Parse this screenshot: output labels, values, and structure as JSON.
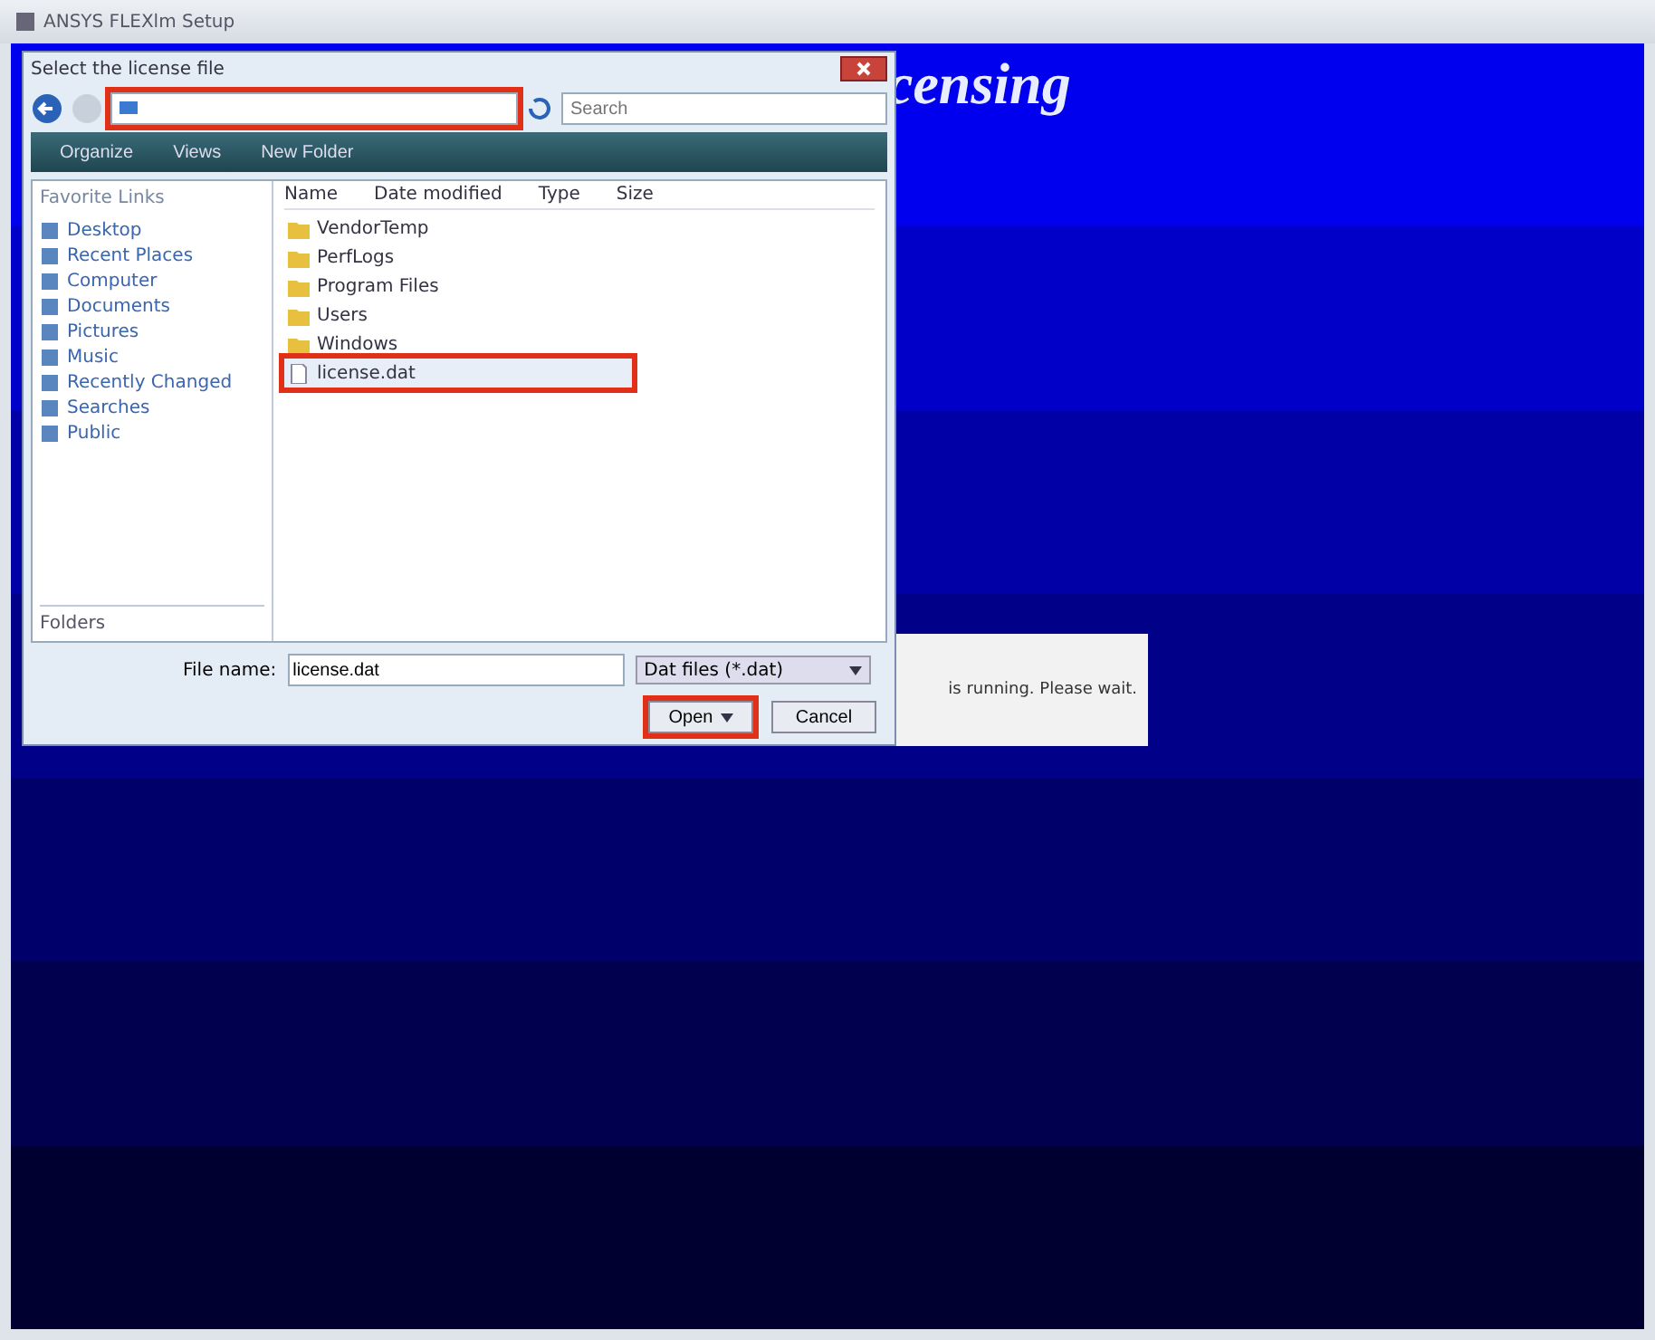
{
  "window": {
    "title": "ANSYS FLEXlm Setup"
  },
  "banner": {
    "text": "censing"
  },
  "message_box": {
    "text": "is running. Please wait."
  },
  "dialog": {
    "title": "Select the license file",
    "address": {
      "highlighted": true
    },
    "search": {
      "placeholder": "Search"
    },
    "toolbar": [
      "Organize",
      "Views",
      "New Folder"
    ],
    "favorites_heading": "Favorite Links",
    "favorites": [
      "Desktop",
      "Recent Places",
      "Computer",
      "Documents",
      "Pictures",
      "Music",
      "Recently Changed",
      "Searches",
      "Public"
    ],
    "folders_label": "Folders",
    "columns": [
      "Name",
      "Date modified",
      "Type",
      "Size"
    ],
    "files": [
      {
        "name": "VendorTemp",
        "kind": "folder",
        "selected": false,
        "highlighted": false
      },
      {
        "name": "PerfLogs",
        "kind": "folder",
        "selected": false,
        "highlighted": false
      },
      {
        "name": "Program Files",
        "kind": "folder",
        "selected": false,
        "highlighted": false
      },
      {
        "name": "Users",
        "kind": "folder",
        "selected": false,
        "highlighted": false
      },
      {
        "name": "Windows",
        "kind": "folder",
        "selected": false,
        "highlighted": false
      },
      {
        "name": "license.dat",
        "kind": "file",
        "selected": true,
        "highlighted": true
      }
    ],
    "filename_label": "File name:",
    "filename": "license.dat",
    "filetype": "Dat files (*.dat)",
    "buttons": [
      {
        "label": "Open",
        "kind": "split",
        "highlighted": true
      },
      {
        "label": "Cancel",
        "kind": "plain",
        "highlighted": false
      }
    ]
  }
}
